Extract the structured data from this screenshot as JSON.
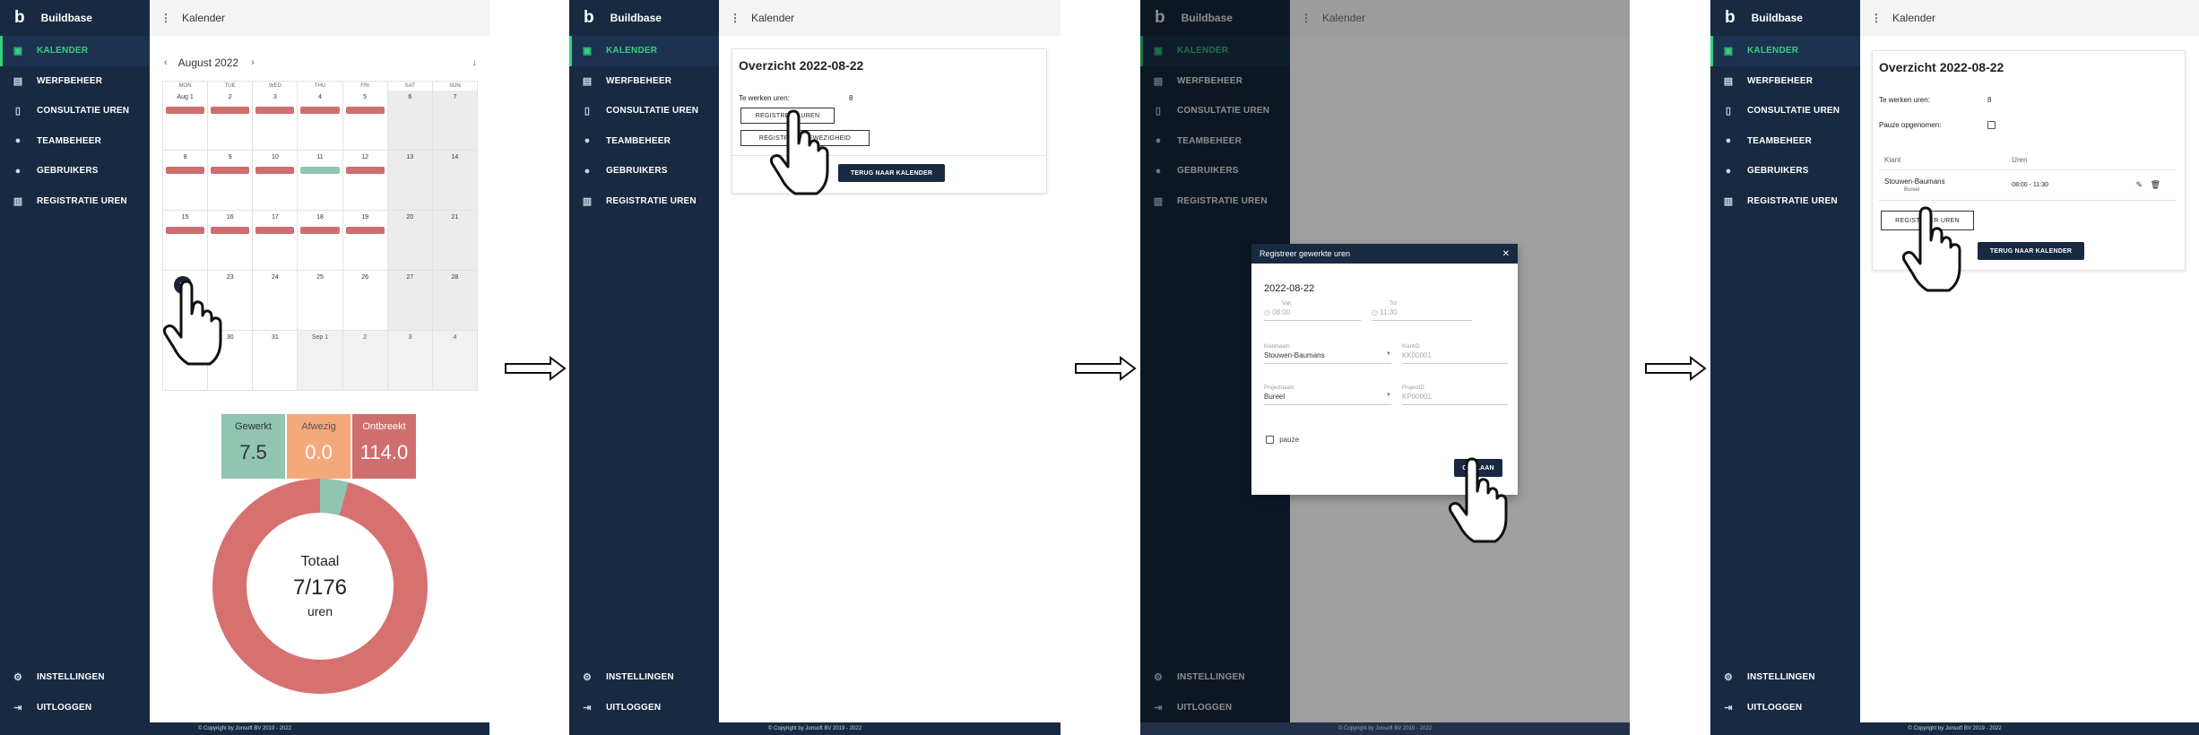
{
  "app": {
    "logo_letter": "b",
    "name": "Buildbase",
    "page_title": "Kalender",
    "kebab": "⋮",
    "footer": "© Copyright by Jonsoft BV 2019 - 2022"
  },
  "nav": {
    "items": [
      {
        "label": "KALENDER",
        "icon": "calendar-icon"
      },
      {
        "label": "WERFBEHEER",
        "icon": "id-card-icon"
      },
      {
        "label": "CONSULTATIE UREN",
        "icon": "document-icon"
      },
      {
        "label": "TEAMBEHEER",
        "icon": "team-icon"
      },
      {
        "label": "GEBRUIKERS",
        "icon": "users-icon"
      },
      {
        "label": "REGISTRATIE UREN",
        "icon": "register-icon"
      }
    ],
    "bottom": [
      {
        "label": "INSTELLINGEN",
        "icon": "gear-icon"
      },
      {
        "label": "UITLOGGEN",
        "icon": "logout-icon"
      }
    ]
  },
  "calendar": {
    "month": "August 2022",
    "prev": "‹",
    "next": "›",
    "download": "↓",
    "days_of_week": [
      "MON",
      "TUE",
      "WED",
      "THU",
      "FRI",
      "SAT",
      "SUN"
    ],
    "weeks": [
      [
        "Aug 1",
        "2",
        "3",
        "4",
        "5",
        "6",
        "7"
      ],
      [
        "8",
        "9",
        "10",
        "11",
        "12",
        "13",
        "14"
      ],
      [
        "15",
        "16",
        "17",
        "18",
        "19",
        "20",
        "21"
      ],
      [
        "22",
        "23",
        "24",
        "25",
        "26",
        "27",
        "28"
      ],
      [
        "29",
        "30",
        "31",
        "Sep 1",
        "2",
        "3",
        "4"
      ]
    ],
    "event_colors": {
      "missing": "#cf6e6e",
      "absent": "#8fc5b1"
    }
  },
  "stats": {
    "worked": {
      "label": "Gewerkt",
      "value": "7.5",
      "color": "#8fc5b1"
    },
    "absent": {
      "label": "Afwezig",
      "value": "0.0",
      "color": "#f4a97c"
    },
    "missing": {
      "label": "Ontbreekt",
      "value": "114.0",
      "color": "#cf6e6e"
    }
  },
  "donut": {
    "label": "Totaal",
    "value": "7/176",
    "unit": "uren",
    "worked_fraction": 0.0426
  },
  "overview": {
    "title": "Overzicht 2022-08-22",
    "hours_label": "Te werken uren:",
    "hours_value": "8",
    "pause_label": "Pauze opgenomen:",
    "btn_register": "REGISTREER UREN",
    "btn_absence": "REGISTREER AFWEZIGHEID",
    "btn_back": "TERUG NAAR KALENDER",
    "table_headers": [
      "Klant",
      "Uren"
    ],
    "rows": [
      {
        "client": "Stouwen-Baumans",
        "project": "Bureel",
        "hours": "08:00 - 11:30"
      }
    ]
  },
  "modal": {
    "title": "Registreer gewerkte uren",
    "close": "✕",
    "date": "2022-08-22",
    "from_label": "Van",
    "from_value": "08:00",
    "to_label": "Tot",
    "to_value": "11:30",
    "client_label": "Klantnaam",
    "client_value": "Stouwen-Baumans",
    "client_id_label": "KlantID",
    "client_id_value": "KK00001",
    "project_label": "Projectnaam",
    "project_value": "Bureel",
    "project_id_label": "ProjectID",
    "project_id_value": "KP00001",
    "pause_label": "pauze",
    "save": "OPSLAAN"
  }
}
